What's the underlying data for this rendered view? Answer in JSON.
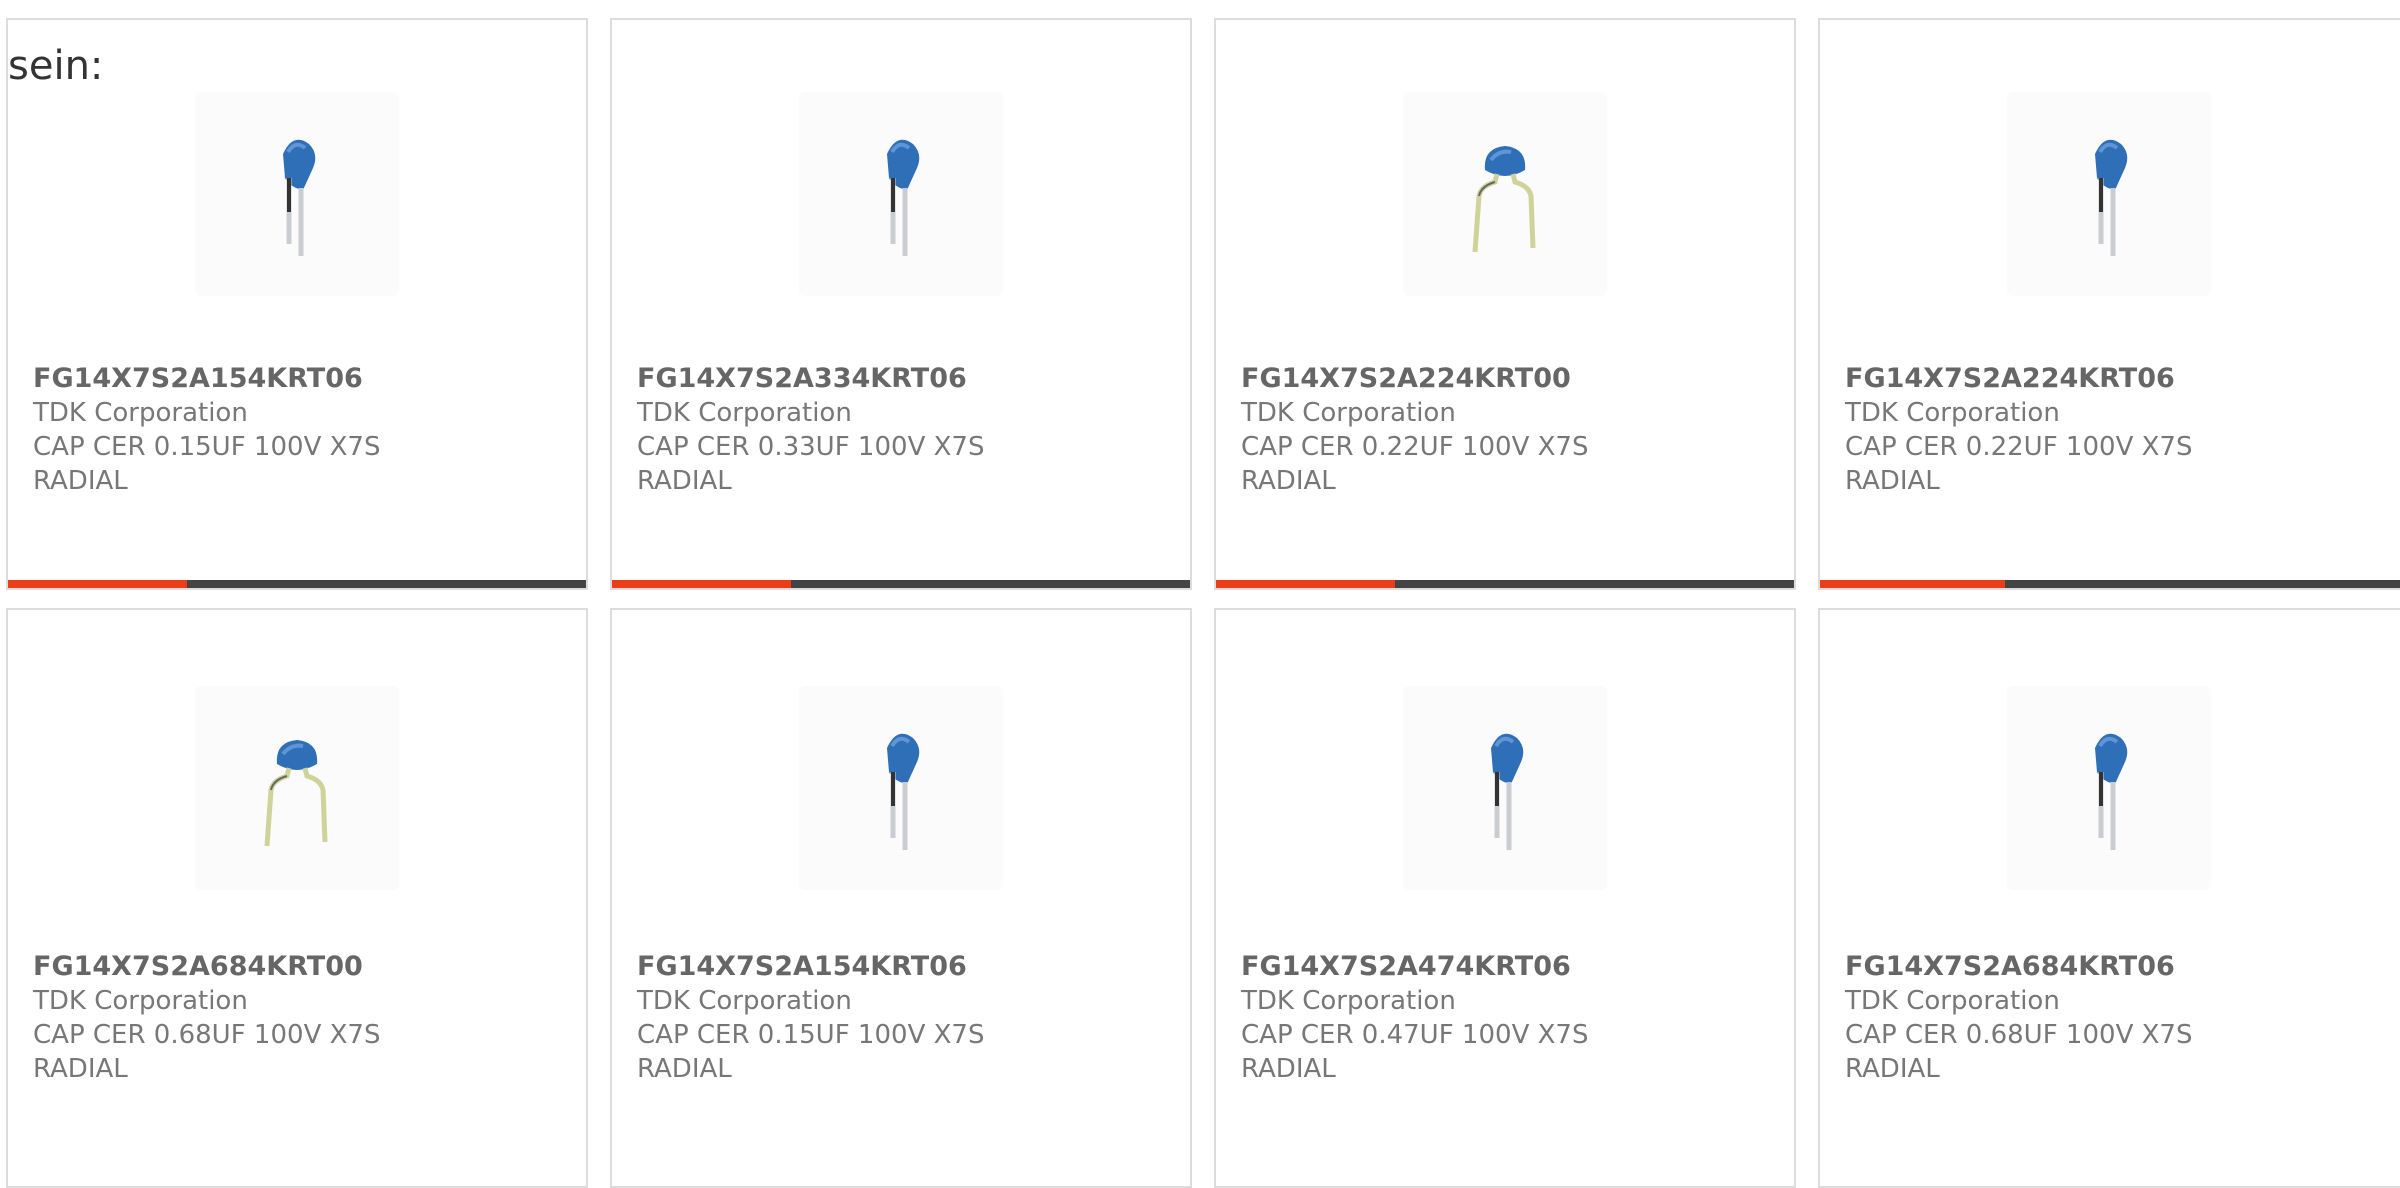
{
  "intro_text": "sein:",
  "products": [
    {
      "part": "FG14X7S2A154KRT06",
      "manufacturer": "TDK Corporation",
      "description": "CAP CER 0.15UF 100V X7S RADIAL",
      "image_icon": "capacitor-side-icon",
      "rating_fraction": 0.31
    },
    {
      "part": "FG14X7S2A334KRT06",
      "manufacturer": "TDK Corporation",
      "description": "CAP CER 0.33UF 100V X7S RADIAL",
      "image_icon": "capacitor-side-icon",
      "rating_fraction": 0.31
    },
    {
      "part": "FG14X7S2A224KRT00",
      "manufacturer": "TDK Corporation",
      "description": "CAP CER 0.22UF 100V X7S RADIAL",
      "image_icon": "capacitor-front-icon",
      "rating_fraction": 0.31
    },
    {
      "part": "FG14X7S2A224KRT06",
      "manufacturer": "TDK Corporation",
      "description": "CAP CER 0.22UF 100V X7S RADIAL",
      "image_icon": "capacitor-side-icon",
      "rating_fraction": 0.31
    },
    {
      "part": "FG14X7S2A684KRT00",
      "manufacturer": "TDK Corporation",
      "description": "CAP CER 0.68UF 100V X7S RADIAL",
      "image_icon": "capacitor-front-icon"
    },
    {
      "part": "FG14X7S2A154KRT06",
      "manufacturer": "TDK Corporation",
      "description": "CAP CER 0.15UF 100V X7S RADIAL",
      "image_icon": "capacitor-side-icon"
    },
    {
      "part": "FG14X7S2A474KRT06",
      "manufacturer": "TDK Corporation",
      "description": "CAP CER 0.47UF 100V X7S RADIAL",
      "image_icon": "capacitor-side-icon"
    },
    {
      "part": "FG14X7S2A684KRT06",
      "manufacturer": "TDK Corporation",
      "description": "CAP CER 0.68UF 100V X7S RADIAL",
      "image_icon": "capacitor-side-icon"
    }
  ],
  "colors": {
    "accent": "#ea3f16",
    "bar_track": "#444444",
    "capacitor_body": "#2f6fb8",
    "card_border": "#dcdcdc"
  }
}
